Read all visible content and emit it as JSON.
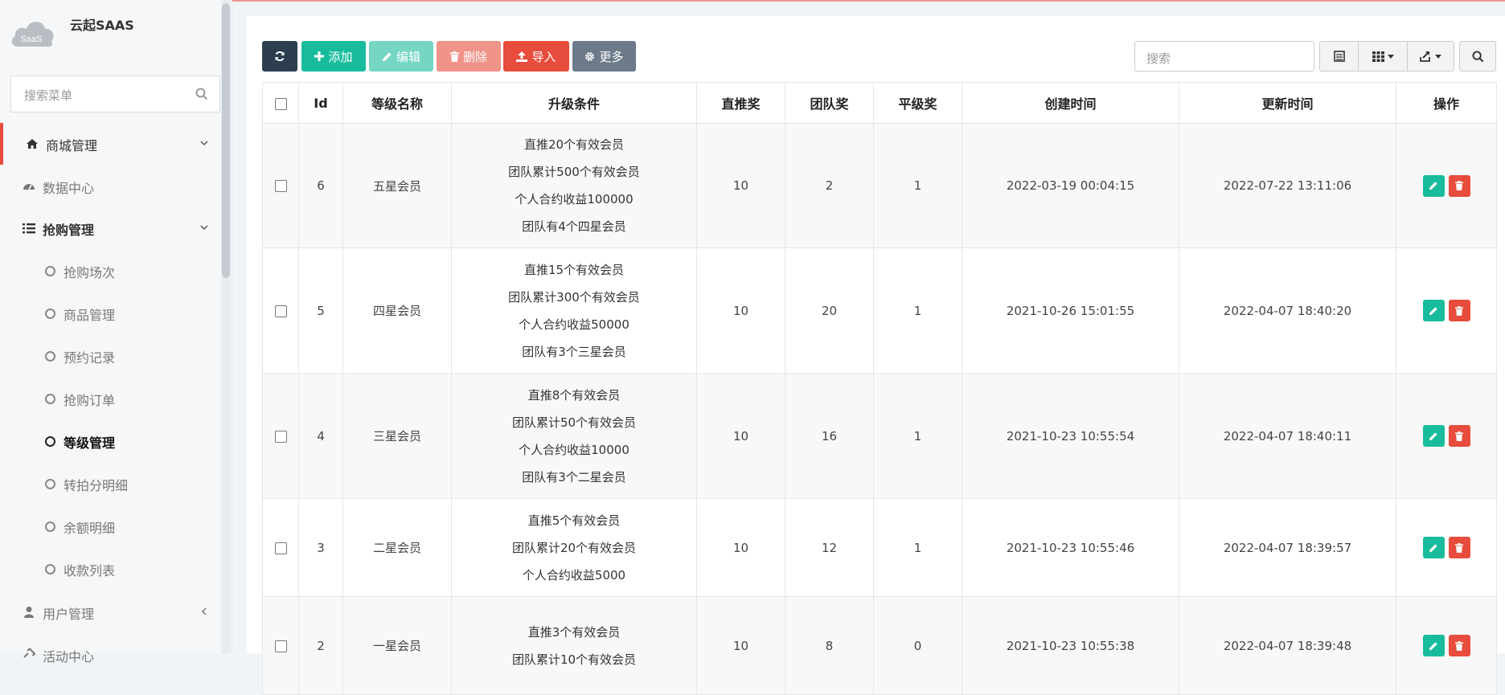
{
  "app": {
    "title": "云起SAAS",
    "logo_text": "SaaS"
  },
  "sidebar": {
    "search_placeholder": "搜索菜单",
    "menu": [
      {
        "label": "商城管理",
        "icon": "home-icon",
        "state": "expanded"
      },
      {
        "label": "数据中心",
        "icon": "dashboard-icon"
      },
      {
        "label": "抢购管理",
        "icon": "list-icon",
        "state": "expanded"
      },
      {
        "label": "用户管理",
        "icon": "user-icon",
        "state": "collapsed"
      },
      {
        "label": "活动中心",
        "icon": "link-icon"
      }
    ],
    "submenu": [
      {
        "label": "抢购场次"
      },
      {
        "label": "商品管理"
      },
      {
        "label": "预约记录"
      },
      {
        "label": "抢购订单"
      },
      {
        "label": "等级管理",
        "current": true
      },
      {
        "label": "转拍分明细"
      },
      {
        "label": "余额明细"
      },
      {
        "label": "收款列表"
      }
    ]
  },
  "toolbar": {
    "add": "添加",
    "edit": "编辑",
    "delete": "删除",
    "import": "导入",
    "more": "更多",
    "search_placeholder": "搜索"
  },
  "table": {
    "columns": [
      "Id",
      "等级名称",
      "升级条件",
      "直推奖",
      "团队奖",
      "平级奖",
      "创建时间",
      "更新时间",
      "操作"
    ],
    "rows": [
      {
        "id": "6",
        "name": "五星会员",
        "conditions": [
          "直推20个有效会员",
          "团队累计500个有效会员",
          "个人合约收益100000",
          "团队有4个四星会员"
        ],
        "direct": "10",
        "team": "2",
        "peer": "1",
        "created": "2022-03-19 00:04:15",
        "updated": "2022-07-22 13:11:06"
      },
      {
        "id": "5",
        "name": "四星会员",
        "conditions": [
          "直推15个有效会员",
          "团队累计300个有效会员",
          "个人合约收益50000",
          "团队有3个三星会员"
        ],
        "direct": "10",
        "team": "20",
        "peer": "1",
        "created": "2021-10-26 15:01:55",
        "updated": "2022-04-07 18:40:20"
      },
      {
        "id": "4",
        "name": "三星会员",
        "conditions": [
          "直推8个有效会员",
          "团队累计50个有效会员",
          "个人合约收益10000",
          "团队有3个二星会员"
        ],
        "direct": "10",
        "team": "16",
        "peer": "1",
        "created": "2021-10-23 10:55:54",
        "updated": "2022-04-07 18:40:11"
      },
      {
        "id": "3",
        "name": "二星会员",
        "conditions": [
          "直推5个有效会员",
          "团队累计20个有效会员",
          "个人合约收益5000"
        ],
        "direct": "10",
        "team": "12",
        "peer": "1",
        "created": "2021-10-23 10:55:46",
        "updated": "2022-04-07 18:39:57"
      },
      {
        "id": "2",
        "name": "一星会员",
        "conditions": [
          "直推3个有效会员",
          "团队累计10个有效会员"
        ],
        "direct": "10",
        "team": "8",
        "peer": "0",
        "created": "2021-10-23 10:55:38",
        "updated": "2022-04-07 18:39:48"
      }
    ]
  },
  "colors": {
    "primary": "#18bc9c",
    "danger": "#e74c3c",
    "dark": "#2c3e50",
    "grey": "#6c7a89"
  }
}
